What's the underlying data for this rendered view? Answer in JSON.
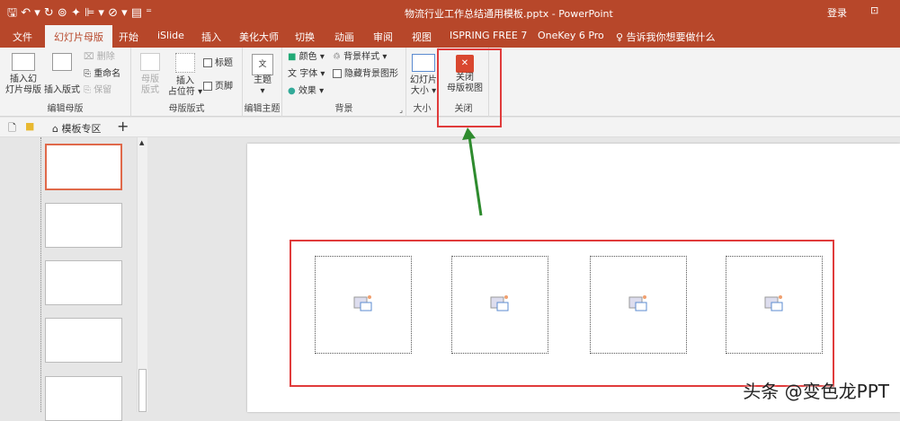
{
  "titlebar": {
    "title": "物流行业工作总结通用模板.pptx  -  PowerPoint",
    "login": "登录"
  },
  "tabs": [
    "文件",
    "幻灯片母版",
    "开始",
    "iSlide",
    "插入",
    "美化大师",
    "切换",
    "动画",
    "审阅",
    "视图",
    "ISPRING FREE 7",
    "OneKey 6 Pro"
  ],
  "tell_me": "告诉我你想要做什么",
  "ribbon": {
    "edit_master": {
      "label": "编辑母版",
      "insert_master": "插入幻\n灯片母版",
      "insert_layout": "插入版式",
      "delete": "删除",
      "rename": "重命名",
      "preserve": "保留"
    },
    "master_layout": {
      "label": "母版版式",
      "master_layout": "母版\n版式",
      "insert_placeholder": "插入\n占位符 ▾",
      "title": "标题",
      "footer": "页脚"
    },
    "edit_theme": {
      "label": "编辑主题",
      "themes": "主题"
    },
    "background": {
      "label": "背景",
      "colors": "颜色 ▾",
      "fonts": "字体 ▾",
      "effects": "效果 ▾",
      "bg_styles": "背景样式 ▾",
      "hide_bg": "隐藏背景图形"
    },
    "size": {
      "label": "大小",
      "slide_size": "幻灯片\n大小 ▾"
    },
    "close": {
      "label": "关闭",
      "close_master": "关闭\n母版视图"
    }
  },
  "tabbar": {
    "tab": "模板专区",
    "add": "+"
  },
  "watermark": "头条 @变色龙PPT",
  "colors": {
    "accent": "#b7472a",
    "highlight": "#e03b3b",
    "arrow": "#2e8b2e"
  }
}
